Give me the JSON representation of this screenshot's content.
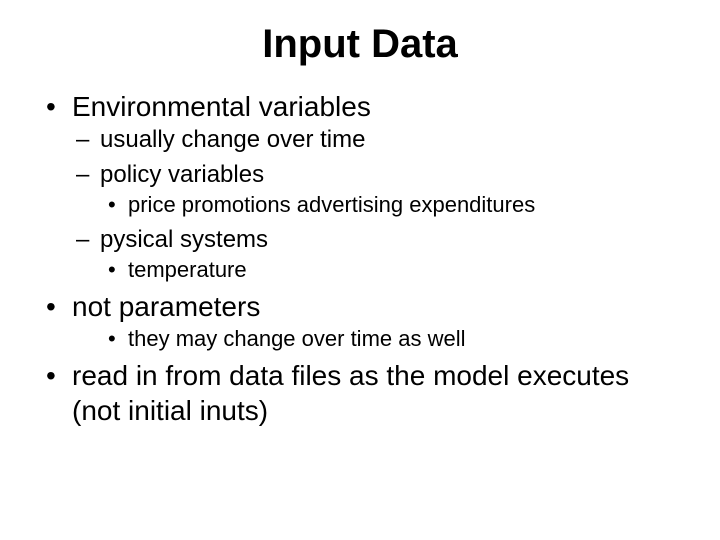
{
  "title": "Input Data",
  "b1": "Environmental variables",
  "b1_1": "usually change over time",
  "b1_2": "policy variables",
  "b1_2_1": "price promotions advertising expenditures",
  "b1_3": "pysical systems",
  "b1_3_1": "temperature",
  "b2": "not parameters",
  "b2_0_1": "they may change over time as well",
  "b3": "read in from data files as the model executes (not initial inuts)"
}
